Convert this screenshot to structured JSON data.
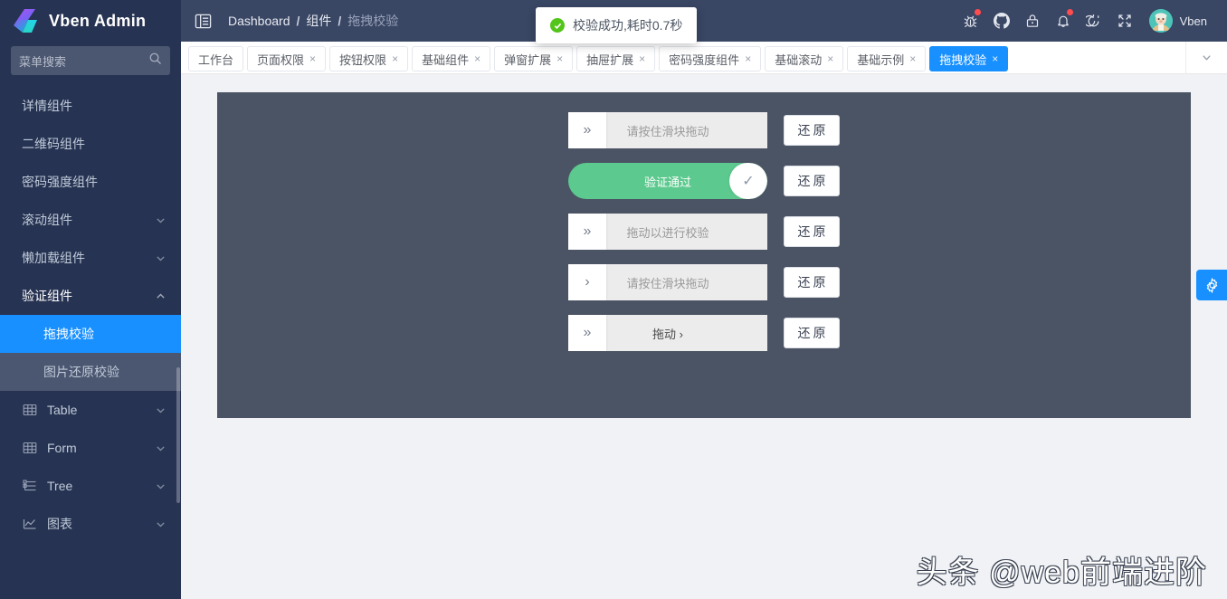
{
  "app": {
    "title": "Vben Admin",
    "accent_blue": "#1890ff",
    "sidebar_bg": "#273352",
    "header_bg": "#394664",
    "card_bg": "#4b5464",
    "success_green": "#5cc98e"
  },
  "sidebar": {
    "logo_label": "Vben Admin",
    "search": {
      "placeholder": "菜单搜索",
      "value": "",
      "icon": "search-icon"
    },
    "items": [
      {
        "label": "详情组件",
        "icon": "",
        "arrow": "",
        "state": "normal"
      },
      {
        "label": "二维码组件",
        "icon": "",
        "arrow": "",
        "state": "normal"
      },
      {
        "label": "密码强度组件",
        "icon": "",
        "arrow": "",
        "state": "normal"
      },
      {
        "label": "滚动组件",
        "icon": "",
        "arrow": "chevron-down-icon",
        "state": "normal"
      },
      {
        "label": "懒加载组件",
        "icon": "",
        "arrow": "chevron-down-icon",
        "state": "normal"
      },
      {
        "label": "验证组件",
        "icon": "",
        "arrow": "chevron-up-icon",
        "state": "expanded"
      },
      {
        "label": "拖拽校验",
        "icon": "",
        "arrow": "",
        "state": "active"
      },
      {
        "label": "图片还原校验",
        "icon": "",
        "arrow": "",
        "state": "submenu"
      },
      {
        "label": "Table",
        "icon": "table-icon",
        "arrow": "chevron-down-icon",
        "state": "normal"
      },
      {
        "label": "Form",
        "icon": "form-icon",
        "arrow": "chevron-down-icon",
        "state": "normal"
      },
      {
        "label": "Tree",
        "icon": "tree-icon",
        "arrow": "chevron-down-icon",
        "state": "normal"
      },
      {
        "label": "图表",
        "icon": "chart-icon",
        "arrow": "chevron-down-icon",
        "state": "normal"
      }
    ]
  },
  "header": {
    "menu_toggle_icon": "menu-fold-icon",
    "breadcrumbs": [
      "Dashboard",
      "组件",
      "拖拽校验"
    ],
    "separator": "/",
    "actions": [
      {
        "name": "bug-icon",
        "badge": true
      },
      {
        "name": "github-icon",
        "badge": false
      },
      {
        "name": "lock-icon",
        "badge": false
      },
      {
        "name": "bell-icon",
        "badge": true
      },
      {
        "name": "refresh-icon",
        "badge": false
      },
      {
        "name": "fullscreen-icon",
        "badge": false
      }
    ],
    "user": {
      "name": "Vben",
      "avatar": "user-avatar"
    }
  },
  "toast": {
    "icon": "check-circle-icon",
    "message": "校验成功,耗时0.7秒"
  },
  "tabs": {
    "items": [
      {
        "label": "工作台",
        "closable": false,
        "active": false
      },
      {
        "label": "页面权限",
        "closable": true,
        "active": false
      },
      {
        "label": "按钮权限",
        "closable": true,
        "active": false
      },
      {
        "label": "基础组件",
        "closable": true,
        "active": false
      },
      {
        "label": "弹窗扩展",
        "closable": true,
        "active": false
      },
      {
        "label": "抽屉扩展",
        "closable": true,
        "active": false
      },
      {
        "label": "密码强度组件",
        "closable": true,
        "active": false
      },
      {
        "label": "基础滚动",
        "closable": true,
        "active": false
      },
      {
        "label": "基础示例",
        "closable": true,
        "active": false
      },
      {
        "label": "拖拽校验",
        "closable": true,
        "active": true
      }
    ],
    "close_glyph": "×",
    "dropdown_icon": "chevron-down-icon"
  },
  "content": {
    "verifiers": [
      {
        "text": "请按住滑块拖动",
        "handle_glyph": "»",
        "state": "idle",
        "shape": "square",
        "restore_label": "还原"
      },
      {
        "text": "验证通过",
        "handle_glyph": "✓",
        "state": "success",
        "shape": "round",
        "restore_label": "还原"
      },
      {
        "text": "拖动以进行校验",
        "handle_glyph": "»",
        "state": "idle",
        "shape": "square",
        "restore_label": "还原"
      },
      {
        "text": "请按住滑块拖动",
        "handle_glyph": "›",
        "state": "idle",
        "shape": "square",
        "restore_label": "还原"
      },
      {
        "text": "拖动 ›",
        "handle_glyph": "»",
        "state": "idle-dark",
        "shape": "square",
        "restore_label": "还原"
      }
    ]
  },
  "settings_drawer": {
    "icon": "gear-icon"
  },
  "watermark": {
    "text": "头条 @web前端进阶"
  }
}
